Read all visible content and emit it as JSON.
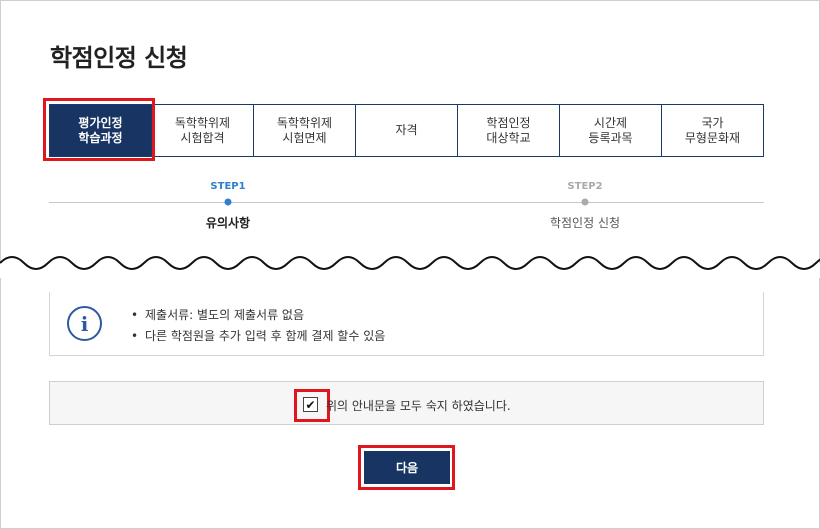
{
  "page": {
    "title": "학점인정 신청"
  },
  "tabs": [
    {
      "label": "평가인정\n학습과정",
      "active": true
    },
    {
      "label": "독학학위제\n시험합격",
      "active": false
    },
    {
      "label": "독학학위제\n시험면제",
      "active": false
    },
    {
      "label": "자격",
      "active": false
    },
    {
      "label": "학점인정\n대상학교",
      "active": false
    },
    {
      "label": "시간제\n등록과목",
      "active": false
    },
    {
      "label": "국가\n무형문화재",
      "active": false
    }
  ],
  "steps": [
    {
      "label": "STEP1",
      "name": "유의사항",
      "active": true
    },
    {
      "label": "STEP2",
      "name": "학점인정 신청",
      "active": false
    }
  ],
  "info": {
    "icon": "info-icon",
    "items": [
      "제출서류: 별도의 제출서류 없음",
      "다른 학점원을 추가 입력 후 함께 결제 할수 있음"
    ]
  },
  "agreement": {
    "checked_mark": "☑",
    "text": "위의 안내문을 모두 숙지 하였습니다."
  },
  "next_button": {
    "label": "다음"
  },
  "colors": {
    "accent": "#173463",
    "highlight": "#e0161e",
    "step_active": "#2f7fd0",
    "step_inactive": "#aaaaaa"
  }
}
